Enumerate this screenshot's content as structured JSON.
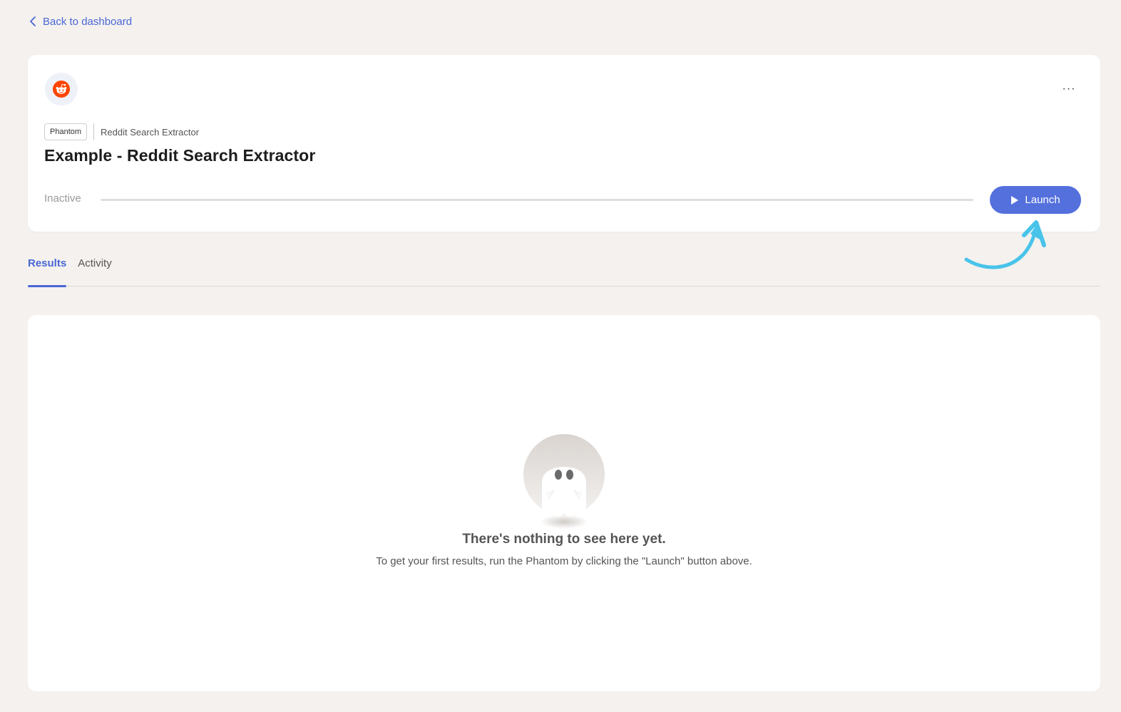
{
  "nav": {
    "back_label": "Back to dashboard"
  },
  "agent": {
    "logo_icon": "reddit-icon",
    "type_badge": "Phantom",
    "template_name": "Reddit Search Extractor",
    "title": "Example - Reddit Search Extractor",
    "status": "Inactive",
    "progress": 0,
    "launch_label": "Launch",
    "more_label": "···"
  },
  "tabs": [
    {
      "label": "Results",
      "active": true
    },
    {
      "label": "Activity",
      "active": false
    }
  ],
  "empty_state": {
    "icon": "ghost-icon",
    "title": "There's nothing to see here yet.",
    "subtitle": "To get your first results, run the Phantom by clicking the \"Launch\" button above."
  },
  "colors": {
    "accent": "#5470dd",
    "link": "#4a67d6",
    "background": "#f4f1ee",
    "reddit": "#ff4500",
    "annotation_arrow": "#49c3ea"
  }
}
